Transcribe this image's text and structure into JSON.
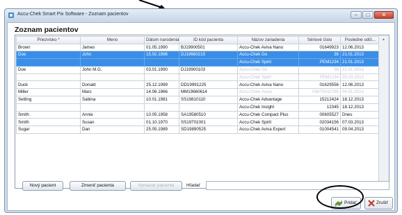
{
  "window": {
    "title": "Accu-Chek Smart Pix Software - Zoznam pacientov"
  },
  "heading": "Zoznam pacientov",
  "table": {
    "columns": [
      "Priezvisko *",
      "Meno",
      "Dátum narodenia",
      "ID kód pacienta",
      "Názov zariadenia",
      "Sériové číslo",
      "Posledné odčí..."
    ],
    "rows": [
      {
        "surname": "Brown",
        "name": "James",
        "dob": "01.05.1990",
        "id": "BJ19900501",
        "device": "Accu-Chek Aviva Nano",
        "serial": "01649923",
        "last": "12.06.2013",
        "selected": false,
        "dim": false
      },
      {
        "surname": "Doe",
        "name": "John",
        "dob": "15.02.1996",
        "id": "DJ19660215",
        "device": "Accu-Chek Go",
        "serial": "36",
        "last": "21.01.2013",
        "selected": true,
        "dim": false
      },
      {
        "surname": "",
        "name": "",
        "dob": "",
        "id": "",
        "device": "Accu-Chek Spirit",
        "serial": "PEM1234",
        "last": "21.01.2013",
        "selected": true,
        "dim": false
      },
      {
        "surname": "Doe",
        "name": "John M.G.",
        "dob": "03.01.1990",
        "id": "DJ19900103",
        "device": "Accu-Chek Go",
        "serial": "36",
        "last": "21.01.2013",
        "selected": false,
        "dim": true
      },
      {
        "surname": "",
        "name": "",
        "dob": "",
        "id": "",
        "device": "Accu-Chek Spirit",
        "serial": "PEM1234",
        "last": "05.03.2013",
        "selected": false,
        "dim": true
      },
      {
        "surname": "Duck",
        "name": "Donald",
        "dob": "25.12.1999",
        "id": "DD19991225",
        "device": "Accu-Chek Aviva Nano",
        "serial": "01629556",
        "last": "12.06.2013",
        "selected": false,
        "dim": false
      },
      {
        "surname": "Miller",
        "name": "Marc",
        "dob": "14.06.1966",
        "id": "MM19660614",
        "device": "Accu-Chek Aviva",
        "serial": "05875432789",
        "last": "04.01.2013",
        "selected": false,
        "dim": true
      },
      {
        "surname": "Setting",
        "name": "Sabina",
        "dob": "10.01.1981",
        "id": "SS19810110",
        "device": "Accu-Chek Advantage",
        "serial": "15212424",
        "last": "18.12.2013",
        "selected": false,
        "dim": false
      },
      {
        "surname": "",
        "name": "",
        "dob": "",
        "id": "",
        "device": "Accu-Chek Insight",
        "serial": "12345",
        "last": "18.12.2013",
        "selected": false,
        "dim": false
      },
      {
        "surname": "Smith",
        "name": "Annie",
        "dob": "10.05.1958",
        "id": "SA19580510",
        "device": "Accu-Chek Compact Plus",
        "serial": "00605527",
        "last": "Dnes",
        "selected": false,
        "dim": false
      },
      {
        "surname": "Smith",
        "name": "Susan",
        "dob": "01.10.1970",
        "id": "SS19701001",
        "device": "Accu-Chek Spirit",
        "serial": "02034156",
        "last": "07.03.2013",
        "selected": false,
        "dim": false
      },
      {
        "surname": "Sugar",
        "name": "Dan",
        "dob": "25.05.1989",
        "id": "SD19890525",
        "device": "Accu-Chek Aviva Expert",
        "serial": "01004541",
        "last": "09.04.2013",
        "selected": false,
        "dim": false
      }
    ]
  },
  "buttons": {
    "new_patient": "Nový pacient",
    "edit_patient": "Zmeniť pacienta",
    "delete_patient": "Vymazať pacienta",
    "search_label": "Hľadať",
    "search_value": "",
    "add": "Pridať",
    "cancel": "Zrušiť"
  },
  "colors": {
    "selection": "#3a8ee6",
    "accent_red": "#c2412d"
  }
}
